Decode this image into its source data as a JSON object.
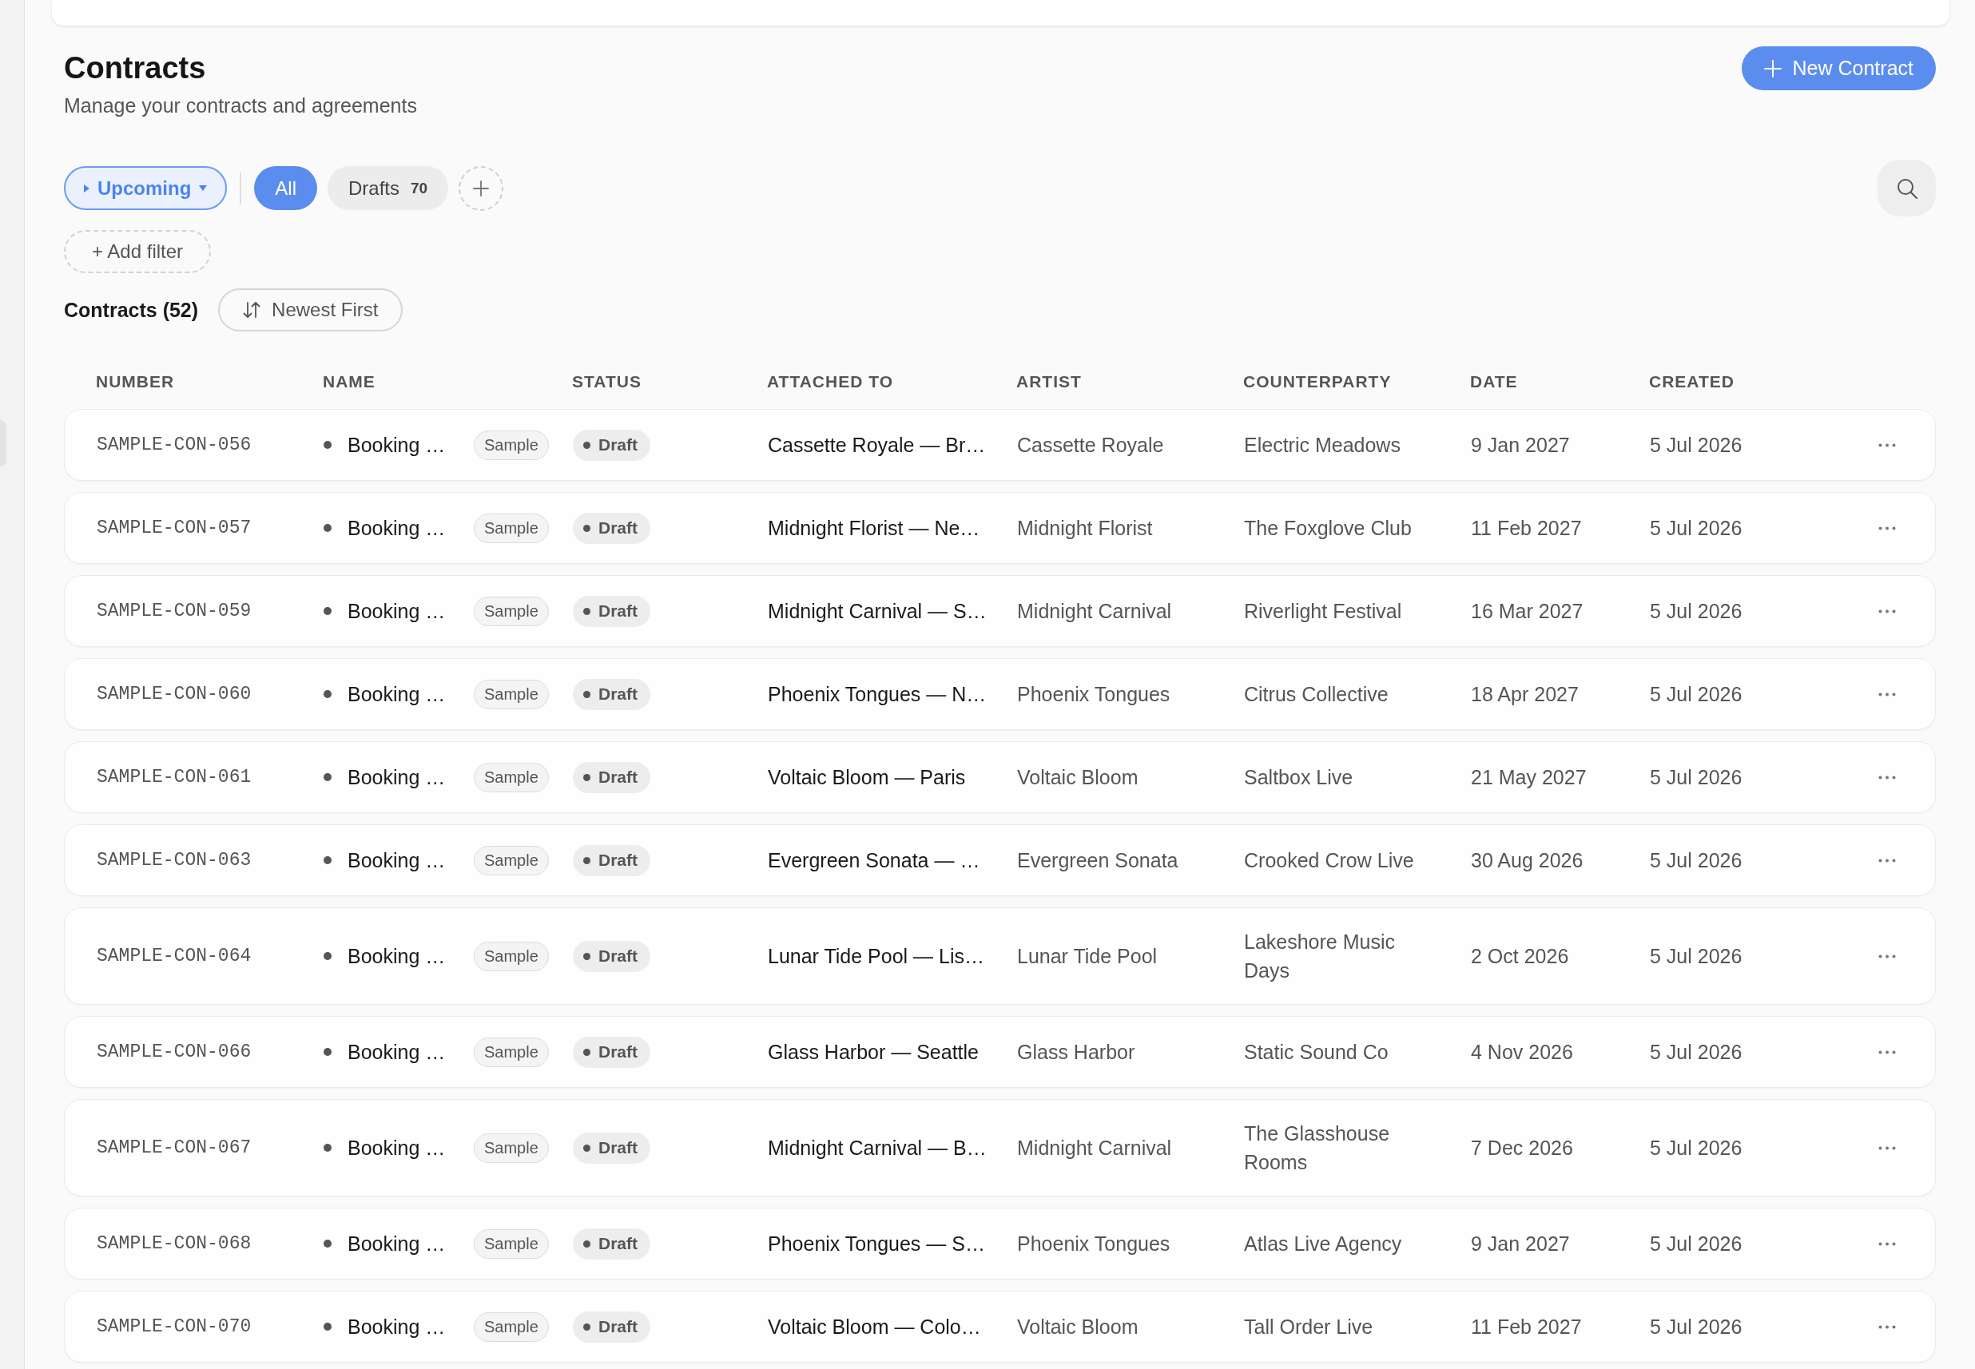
{
  "page": {
    "title": "Contracts",
    "subtitle": "Manage your contracts and agreements"
  },
  "new_button": {
    "label": "New Contract"
  },
  "view_dropdown": {
    "label": "Upcoming",
    "active": true
  },
  "tabs": [
    {
      "label": "All",
      "selected": true
    },
    {
      "label": "Drafts",
      "count": "70",
      "selected": false
    }
  ],
  "add_filter": {
    "label": "+ Add filter"
  },
  "list_heading": "Contracts (52)",
  "sort_button": {
    "label": "Newest First"
  },
  "table": {
    "columns": [
      "NUMBER",
      "NAME",
      "STATUS",
      "ATTACHED TO",
      "ARTIST",
      "COUNTERPARTY",
      "DATE",
      "CREATED"
    ],
    "rows": [
      {
        "number": "SAMPLE-CON-056",
        "name": "Booking …",
        "tag": "Sample",
        "status": "Draft",
        "attached_to": "Cassette Royale — Br…",
        "artist": "Cassette Royale",
        "counterparty": "Electric Meadows",
        "date": "9 Jan 2027",
        "created": "5 Jul 2026"
      },
      {
        "number": "SAMPLE-CON-057",
        "name": "Booking …",
        "tag": "Sample",
        "status": "Draft",
        "attached_to": "Midnight Florist — Ne…",
        "artist": "Midnight Florist",
        "counterparty": "The Foxglove Club",
        "date": "11 Feb 2027",
        "created": "5 Jul 2026"
      },
      {
        "number": "SAMPLE-CON-059",
        "name": "Booking …",
        "tag": "Sample",
        "status": "Draft",
        "attached_to": "Midnight Carnival — S…",
        "artist": "Midnight Carnival",
        "counterparty": "Riverlight Festival",
        "date": "16 Mar 2027",
        "created": "5 Jul 2026"
      },
      {
        "number": "SAMPLE-CON-060",
        "name": "Booking …",
        "tag": "Sample",
        "status": "Draft",
        "attached_to": "Phoenix Tongues — N…",
        "artist": "Phoenix Tongues",
        "counterparty": "Citrus Collective",
        "date": "18 Apr 2027",
        "created": "5 Jul 2026"
      },
      {
        "number": "SAMPLE-CON-061",
        "name": "Booking …",
        "tag": "Sample",
        "status": "Draft",
        "attached_to": "Voltaic Bloom — Paris",
        "artist": "Voltaic Bloom",
        "counterparty": "Saltbox Live",
        "date": "21 May 2027",
        "created": "5 Jul 2026"
      },
      {
        "number": "SAMPLE-CON-063",
        "name": "Booking …",
        "tag": "Sample",
        "status": "Draft",
        "attached_to": "Evergreen Sonata — …",
        "artist": "Evergreen Sonata",
        "counterparty": "Crooked Crow Live",
        "date": "30 Aug 2026",
        "created": "5 Jul 2026"
      },
      {
        "number": "SAMPLE-CON-064",
        "name": "Booking …",
        "tag": "Sample",
        "status": "Draft",
        "attached_to": "Lunar Tide Pool — Lis…",
        "artist": "Lunar Tide Pool",
        "counterparty": "Lakeshore Music Days",
        "date": "2 Oct 2026",
        "created": "5 Jul 2026"
      },
      {
        "number": "SAMPLE-CON-066",
        "name": "Booking …",
        "tag": "Sample",
        "status": "Draft",
        "attached_to": "Glass Harbor — Seattle",
        "artist": "Glass Harbor",
        "counterparty": "Static Sound Co",
        "date": "4 Nov 2026",
        "created": "5 Jul 2026"
      },
      {
        "number": "SAMPLE-CON-067",
        "name": "Booking …",
        "tag": "Sample",
        "status": "Draft",
        "attached_to": "Midnight Carnival — B…",
        "artist": "Midnight Carnival",
        "counterparty": "The Glasshouse Rooms",
        "date": "7 Dec 2026",
        "created": "5 Jul 2026"
      },
      {
        "number": "SAMPLE-CON-068",
        "name": "Booking …",
        "tag": "Sample",
        "status": "Draft",
        "attached_to": "Phoenix Tongues — S…",
        "artist": "Phoenix Tongues",
        "counterparty": "Atlas Live Agency",
        "date": "9 Jan 2027",
        "created": "5 Jul 2026"
      },
      {
        "number": "SAMPLE-CON-070",
        "name": "Booking …",
        "tag": "Sample",
        "status": "Draft",
        "attached_to": "Voltaic Bloom — Colo…",
        "artist": "Voltaic Bloom",
        "counterparty": "Tall Order Live",
        "date": "11 Feb 2027",
        "created": "5 Jul 2026"
      }
    ]
  }
}
